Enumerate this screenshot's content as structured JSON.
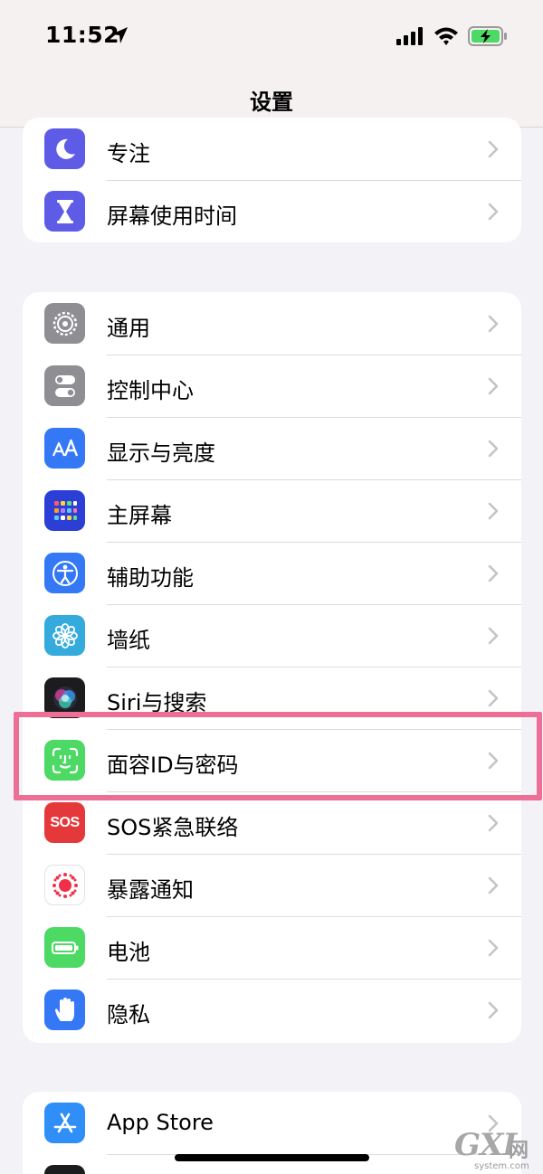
{
  "status_bar": {
    "time": "11:52"
  },
  "nav": {
    "title": "设置"
  },
  "groups": [
    {
      "items": [
        {
          "label": "专注",
          "icon": "moon-icon",
          "color": "#5e5ce6"
        },
        {
          "label": "屏幕使用时间",
          "icon": "hourglass-icon",
          "color": "#5e5ce6"
        }
      ]
    },
    {
      "items": [
        {
          "label": "通用",
          "icon": "gear-icon",
          "color": "#8e8e93"
        },
        {
          "label": "控制中心",
          "icon": "toggles-icon",
          "color": "#8e8e93"
        },
        {
          "label": "显示与亮度",
          "icon": "text-size-icon",
          "color": "#3478f6"
        },
        {
          "label": "主屏幕",
          "icon": "home-grid-icon",
          "color": "#2b3ed6"
        },
        {
          "label": "辅助功能",
          "icon": "accessibility-icon",
          "color": "#3478f6"
        },
        {
          "label": "墙纸",
          "icon": "flower-icon",
          "color": "#35aadc"
        },
        {
          "label": "Siri与搜索",
          "icon": "siri-icon",
          "color": "#1c1c1e"
        },
        {
          "label": "面容ID与密码",
          "icon": "face-id-icon",
          "color": "#4cd964"
        },
        {
          "label": "SOS紧急联络",
          "icon": "sos-icon",
          "color": "#e5383b"
        },
        {
          "label": "暴露通知",
          "icon": "exposure-icon",
          "color": "#ffffff"
        },
        {
          "label": "电池",
          "icon": "battery-icon",
          "color": "#4cd964"
        },
        {
          "label": "隐私",
          "icon": "hand-icon",
          "color": "#3478f6"
        }
      ]
    },
    {
      "items": [
        {
          "label": "App Store",
          "icon": "app-store-icon",
          "color": "#2f8ff7"
        }
      ]
    }
  ],
  "sos_icon_text": "SOS",
  "highlight_color": "#ee6f95",
  "watermark": {
    "main": "GXI",
    "cn": "网",
    "sub": "system.com"
  }
}
